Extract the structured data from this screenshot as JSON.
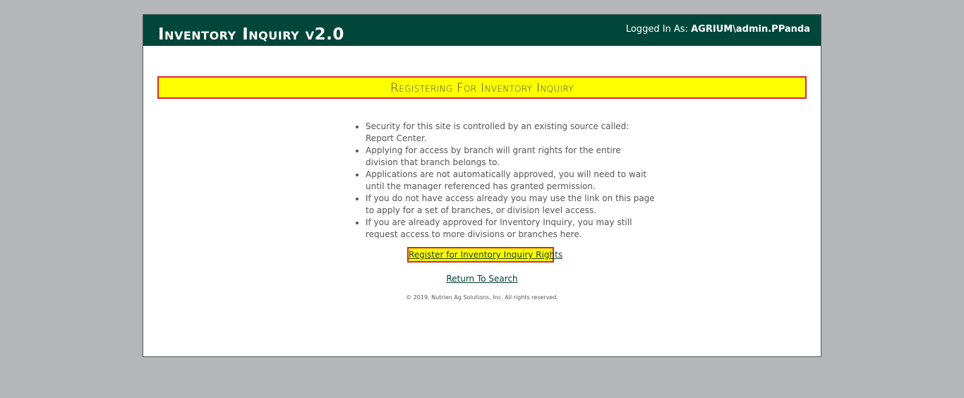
{
  "header": {
    "title": "Inventory Inquiry v2.0",
    "login_label": "Logged In As:",
    "login_user": "AGRIUM\\admin.PPanda"
  },
  "banner": {
    "title": "Registering For Inventory Inquiry"
  },
  "info": {
    "items": [
      "Security for this site is controlled by an existing source called: Report Center.",
      "Applying for access by branch will grant rights for the entire division that branch belongs to.",
      "Applications are not automatically approved, you will need to wait until the manager referenced has granted permission.",
      "If you do not have access already you may use the link on this page to apply for a set of branches, or division level access.",
      "If you are already approved for Inventory Inquiry, you may still request access to more divisions or branches here."
    ]
  },
  "links": {
    "register": "Register for Inventory Inquiry Rights",
    "return": "Return To Search"
  },
  "footer": {
    "copyright": "© 2019, Nutrien Ag Solutions, Inc. All rights reserved."
  },
  "colors": {
    "header_bg": "#00473a",
    "highlight": "#ffff00",
    "highlight_border": "#d9272e",
    "page_bg": "#b5b6ba"
  }
}
